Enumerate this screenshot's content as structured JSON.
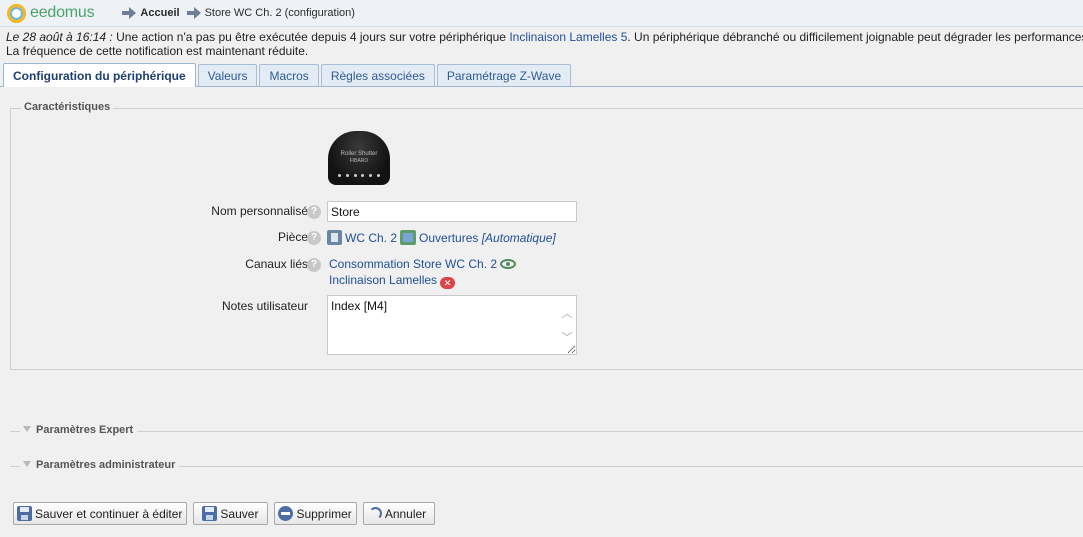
{
  "header": {
    "logo_text": "eedomus",
    "breadcrumb_home": "Accueil",
    "breadcrumb_page": "Store WC Ch. 2 (configuration)"
  },
  "notice": {
    "date": "Le 28 août à 16:14 :",
    "text_before_link": " Une action n'a pas pu être exécutée depuis 4 jours sur votre périphérique ",
    "link": "Inclinaison Lamelles 5",
    "text_after_link": ". Un périphérique débranché ou difficilement joignable peut dégrader les performances",
    "line2": "La fréquence de cette notification est maintenant réduite."
  },
  "tabs": [
    {
      "label": "Configuration du périphérique",
      "active": true
    },
    {
      "label": "Valeurs",
      "active": false
    },
    {
      "label": "Macros",
      "active": false
    },
    {
      "label": "Règles associées",
      "active": false
    },
    {
      "label": "Paramétrage Z-Wave",
      "active": false
    }
  ],
  "characteristics": {
    "legend": "Caractéristiques",
    "device_image_label": "Roller Shutter",
    "device_image_sublabel": "FIBARO",
    "name_label": "Nom personnalisé",
    "name_value": "Store",
    "room_label": "Pièce",
    "room_value": "WC Ch. 2",
    "group_value": "Ouvertures",
    "group_mode": "[Automatique]",
    "channels_label": "Canaux liés",
    "channel_1": "Consommation Store WC Ch. 2",
    "channel_2": "Inclinaison Lamelles",
    "notes_label": "Notes utilisateur",
    "notes_value": "Index [M4]",
    "help_glyph": "?"
  },
  "sections": {
    "expert": "Paramètres Expert",
    "admin": "Paramètres administrateur"
  },
  "buttons": {
    "save_continue": "Sauver et continuer à éditer",
    "save": "Sauver",
    "delete": "Supprimer",
    "cancel": "Annuler"
  },
  "icons": {
    "eye": "eye-icon",
    "unlink": "x-icon",
    "x_glyph": "✕",
    "scroll_up": "︿",
    "scroll_down": "﹀"
  }
}
